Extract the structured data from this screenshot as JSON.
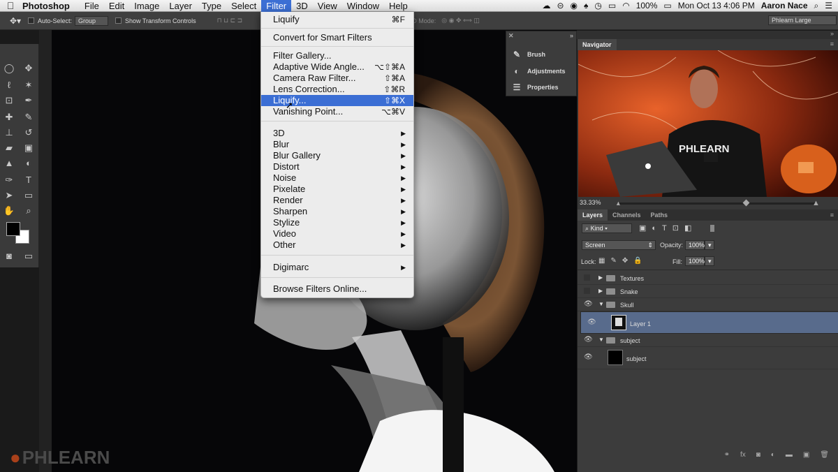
{
  "menubar": {
    "app": "Photoshop",
    "items": [
      "File",
      "Edit",
      "Image",
      "Layer",
      "Type",
      "Select",
      "Filter",
      "3D",
      "View",
      "Window",
      "Help"
    ],
    "active": "Filter",
    "battery": "100%",
    "datetime": "Mon Oct 13  4:06 PM",
    "user": "Aaron Nace"
  },
  "options": {
    "auto_select_label": "Auto-Select:",
    "auto_select_value": "Group",
    "show_transform_label": "Show Transform Controls",
    "mode_3d_label": "3D Mode:",
    "workspace": "Phlearn Large"
  },
  "filter_menu": {
    "items": [
      {
        "label": "Liquify",
        "shortcut": "⌘F",
        "highlight": false
      },
      {
        "label": "Convert for Smart Filters",
        "shortcut": "",
        "highlight": false
      },
      {
        "label": "Filter Gallery...",
        "shortcut": "",
        "highlight": false
      },
      {
        "label": "Adaptive Wide Angle...",
        "shortcut": "⌥⇧⌘A",
        "highlight": false
      },
      {
        "label": "Camera Raw Filter...",
        "shortcut": "⇧⌘A",
        "highlight": false
      },
      {
        "label": "Lens Correction...",
        "shortcut": "⇧⌘R",
        "highlight": false
      },
      {
        "label": "Liquify...",
        "shortcut": "⇧⌘X",
        "highlight": true
      },
      {
        "label": "Vanishing Point...",
        "shortcut": "⌥⌘V",
        "highlight": false
      },
      {
        "label": "3D",
        "submenu": true
      },
      {
        "label": "Blur",
        "submenu": true
      },
      {
        "label": "Blur Gallery",
        "submenu": true
      },
      {
        "label": "Distort",
        "submenu": true
      },
      {
        "label": "Noise",
        "submenu": true
      },
      {
        "label": "Pixelate",
        "submenu": true
      },
      {
        "label": "Render",
        "submenu": true
      },
      {
        "label": "Sharpen",
        "submenu": true
      },
      {
        "label": "Stylize",
        "submenu": true
      },
      {
        "label": "Video",
        "submenu": true
      },
      {
        "label": "Other",
        "submenu": true
      },
      {
        "label": "Digimarc",
        "submenu": true
      },
      {
        "label": "Browse Filters Online..."
      }
    ]
  },
  "adjust_panel": {
    "brush": "Brush",
    "adjustments": "Adjustments",
    "properties": "Properties"
  },
  "navigator": {
    "title": "Navigator",
    "zoom": "33.33%",
    "shirt_text": "PHLEARN"
  },
  "layers_panel": {
    "tabs": [
      "Layers",
      "Channels",
      "Paths"
    ],
    "kind": "Kind",
    "blend_mode": "Screen",
    "opacity_label": "Opacity:",
    "opacity": "100%",
    "lock_label": "Lock:",
    "fill_label": "Fill:",
    "fill": "100%",
    "layers": [
      {
        "name": "Textures",
        "type": "group",
        "visible": false,
        "expanded": false
      },
      {
        "name": "Snake",
        "type": "group",
        "visible": false,
        "expanded": false
      },
      {
        "name": "Skull",
        "type": "group",
        "visible": true,
        "expanded": true
      },
      {
        "name": "Layer 1",
        "type": "layer",
        "visible": true,
        "selected": true
      },
      {
        "name": "subject",
        "type": "group",
        "visible": true,
        "expanded": true
      },
      {
        "name": "subject",
        "type": "layer",
        "visible": true
      }
    ]
  },
  "watermark": "PHLEARN",
  "colors": {
    "menu_highlight": "#3b6ed4",
    "selected_layer": "#586b8c",
    "panel_bg": "#3c3c3c"
  }
}
